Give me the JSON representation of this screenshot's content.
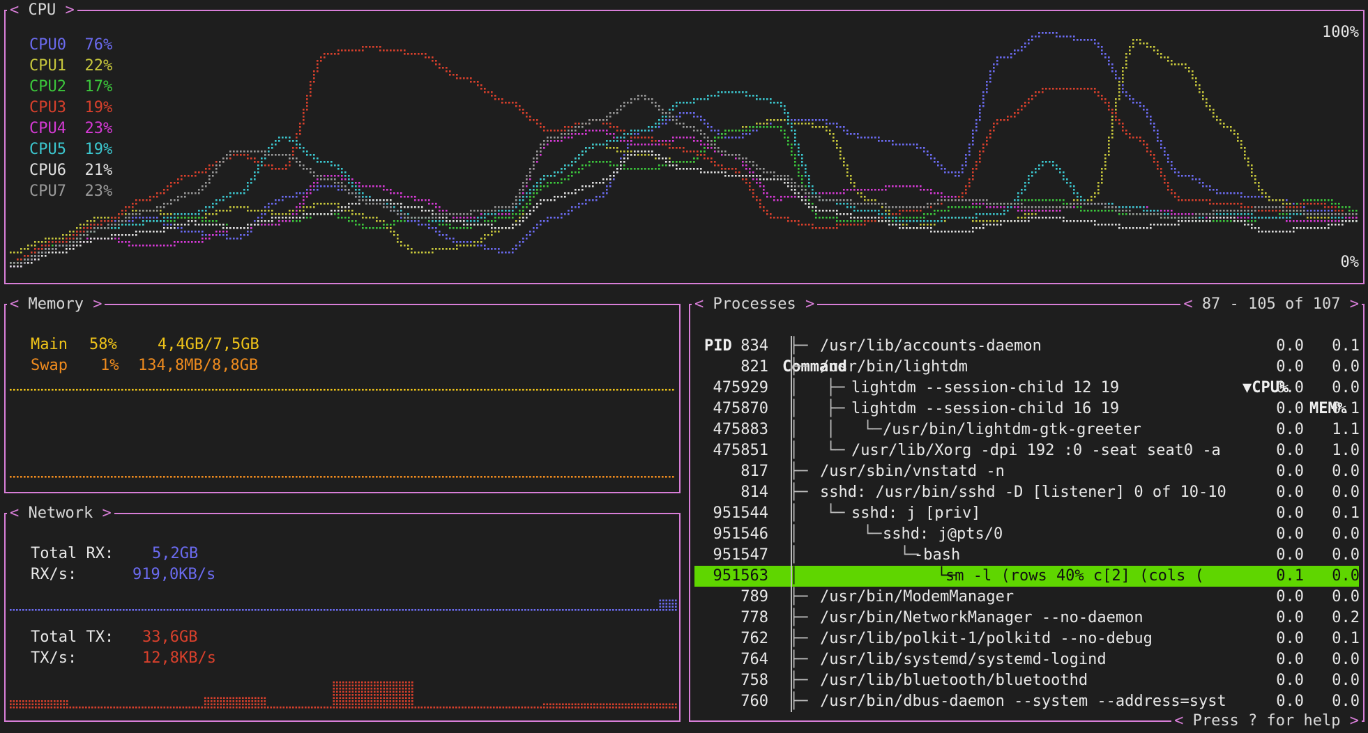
{
  "cpu_panel": {
    "title": "CPU",
    "max_label": "100%",
    "min_label": "0%"
  },
  "cpus": [
    {
      "name": "CPU0",
      "value": "76%",
      "color": "#6b6bf0"
    },
    {
      "name": "CPU1",
      "value": "22%",
      "color": "#c8c83c"
    },
    {
      "name": "CPU2",
      "value": "17%",
      "color": "#3cc83c"
    },
    {
      "name": "CPU3",
      "value": "19%",
      "color": "#d8402c"
    },
    {
      "name": "CPU4",
      "value": "23%",
      "color": "#d63ad6"
    },
    {
      "name": "CPU5",
      "value": "19%",
      "color": "#3cc8d0"
    },
    {
      "name": "CPU6",
      "value": "21%",
      "color": "#e0e0e0"
    },
    {
      "name": "CPU7",
      "value": "23%",
      "color": "#9a9a9a"
    }
  ],
  "memory": {
    "title": "Memory",
    "main": {
      "label": "Main",
      "percent": "58%",
      "amount": "4,4GB/7,5GB",
      "color": "#f0c419"
    },
    "swap": {
      "label": "Swap",
      "percent": "1%",
      "amount": "134,8MB/8,8GB",
      "color": "#f08c1e"
    }
  },
  "network": {
    "title": "Network",
    "rx_total_label": "Total RX:",
    "rx_total": "5,2GB",
    "rx_rate_label": "RX/s:",
    "rx_rate": "919,0KB/s",
    "rx_color": "#6b6bf0",
    "tx_total_label": "Total TX:",
    "tx_total": "33,6GB",
    "tx_rate_label": "TX/s:",
    "tx_rate": "12,8KB/s",
    "tx_color": "#d8402c"
  },
  "processes": {
    "title": "Processes",
    "range": "87 - 105 of 107",
    "footer": "Press ? for help",
    "headers": {
      "pid": "PID",
      "command": "Command",
      "cpu": "▼CPU%",
      "mem": "MEM%"
    },
    "rows": [
      {
        "pid": "834",
        "tree": "├─",
        "cmd": "/usr/lib/accounts-daemon",
        "cpu": "0.0",
        "mem": "0.1",
        "depth": 0
      },
      {
        "pid": "821",
        "tree": "├─",
        "cmd": "/usr/bin/lightdm",
        "cpu": "0.0",
        "mem": "0.0",
        "depth": 0
      },
      {
        "pid": "475929",
        "tree": "│   ├─",
        "cmd": "lightdm --session-child 12 19",
        "cpu": "0.0",
        "mem": "0.0",
        "depth": 1
      },
      {
        "pid": "475870",
        "tree": "│   ├─",
        "cmd": "lightdm --session-child 16 19",
        "cpu": "0.0",
        "mem": "0.1",
        "depth": 1
      },
      {
        "pid": "475883",
        "tree": "│   │   └─",
        "cmd": "/usr/bin/lightdm-gtk-greeter",
        "cpu": "0.0",
        "mem": "1.1",
        "depth": 2
      },
      {
        "pid": "475851",
        "tree": "│   └─",
        "cmd": "/usr/lib/Xorg -dpi 192 :0 -seat seat0 -a",
        "cpu": "0.0",
        "mem": "1.0",
        "depth": 1
      },
      {
        "pid": "817",
        "tree": "├─",
        "cmd": "/usr/sbin/vnstatd -n",
        "cpu": "0.0",
        "mem": "0.0",
        "depth": 0
      },
      {
        "pid": "814",
        "tree": "├─",
        "cmd": "sshd: /usr/bin/sshd -D [listener] 0 of 10-10",
        "cpu": "0.0",
        "mem": "0.0",
        "depth": 0
      },
      {
        "pid": "951544",
        "tree": "│   └─",
        "cmd": "sshd: j [priv]",
        "cpu": "0.0",
        "mem": "0.1",
        "depth": 1
      },
      {
        "pid": "951546",
        "tree": "│       └─",
        "cmd": "sshd: j@pts/0",
        "cpu": "0.0",
        "mem": "0.0",
        "depth": 2
      },
      {
        "pid": "951547",
        "tree": "│           └─",
        "cmd": "-bash",
        "cpu": "0.0",
        "mem": "0.0",
        "depth": 3
      },
      {
        "pid": "951563",
        "tree": "│               └─",
        "cmd": "sm -l (rows 40% c[2] (cols (",
        "cpu": "0.1",
        "mem": "0.0",
        "depth": 4,
        "selected": true
      },
      {
        "pid": "789",
        "tree": "├─",
        "cmd": "/usr/bin/ModemManager",
        "cpu": "0.0",
        "mem": "0.0",
        "depth": 0
      },
      {
        "pid": "778",
        "tree": "├─",
        "cmd": "/usr/bin/NetworkManager --no-daemon",
        "cpu": "0.0",
        "mem": "0.2",
        "depth": 0
      },
      {
        "pid": "762",
        "tree": "├─",
        "cmd": "/usr/lib/polkit-1/polkitd --no-debug",
        "cpu": "0.0",
        "mem": "0.1",
        "depth": 0
      },
      {
        "pid": "764",
        "tree": "├─",
        "cmd": "/usr/lib/systemd/systemd-logind",
        "cpu": "0.0",
        "mem": "0.0",
        "depth": 0
      },
      {
        "pid": "758",
        "tree": "├─",
        "cmd": "/usr/lib/bluetooth/bluetoothd",
        "cpu": "0.0",
        "mem": "0.0",
        "depth": 0
      },
      {
        "pid": "760",
        "tree": "├─",
        "cmd": "/usr/bin/dbus-daemon --system --address=syst",
        "cpu": "0.0",
        "mem": "0.0",
        "depth": 0
      }
    ]
  },
  "chart_data": [
    {
      "type": "line",
      "title": "CPU",
      "ylim": [
        0,
        100
      ],
      "x": [
        0,
        1,
        2,
        3,
        4,
        5,
        6,
        7,
        8,
        9,
        10,
        11,
        12,
        13,
        14,
        15,
        16,
        17,
        18,
        19,
        20,
        21,
        22,
        23,
        24,
        25,
        26,
        27,
        28,
        29,
        30
      ],
      "series": [
        {
          "name": "CPU0",
          "values": [
            2,
            12,
            20,
            22,
            16,
            14,
            30,
            35,
            30,
            20,
            12,
            8,
            22,
            30,
            58,
            65,
            55,
            62,
            62,
            55,
            52,
            40,
            88,
            98,
            95,
            70,
            40,
            32,
            30,
            25,
            22
          ]
        },
        {
          "name": "CPU1",
          "values": [
            8,
            14,
            22,
            25,
            22,
            26,
            24,
            28,
            22,
            8,
            10,
            18,
            40,
            52,
            48,
            45,
            58,
            62,
            60,
            30,
            18,
            22,
            20,
            25,
            30,
            95,
            85,
            60,
            30,
            22,
            20
          ]
        },
        {
          "name": "CPU2",
          "values": [
            4,
            10,
            18,
            20,
            22,
            18,
            20,
            24,
            18,
            22,
            18,
            22,
            36,
            45,
            42,
            45,
            58,
            60,
            22,
            20,
            22,
            26,
            28,
            30,
            25,
            24,
            22,
            20,
            22,
            30,
            25
          ]
        },
        {
          "name": "CPU3",
          "values": [
            4,
            12,
            20,
            30,
            40,
            48,
            42,
            90,
            92,
            90,
            80,
            70,
            58,
            62,
            55,
            50,
            42,
            22,
            18,
            20,
            25,
            30,
            62,
            75,
            75,
            55,
            30,
            28,
            25,
            28,
            22
          ]
        },
        {
          "name": "CPU4",
          "values": [
            2,
            10,
            14,
            10,
            12,
            18,
            20,
            40,
            35,
            30,
            22,
            24,
            54,
            58,
            52,
            55,
            48,
            30,
            32,
            34,
            35,
            30,
            26,
            25,
            28,
            26,
            24,
            22,
            22,
            20,
            22
          ]
        },
        {
          "name": "CPU5",
          "values": [
            3,
            10,
            18,
            20,
            24,
            32,
            55,
            45,
            30,
            22,
            20,
            25,
            40,
            52,
            58,
            70,
            74,
            70,
            30,
            25,
            20,
            22,
            24,
            45,
            28,
            26,
            22,
            24,
            22,
            24,
            20
          ]
        },
        {
          "name": "CPU6",
          "values": [
            2,
            8,
            14,
            16,
            20,
            18,
            22,
            24,
            30,
            26,
            20,
            18,
            30,
            36,
            50,
            42,
            40,
            38,
            25,
            22,
            18,
            16,
            20,
            22,
            20,
            18,
            20,
            22,
            16,
            18,
            21
          ]
        },
        {
          "name": "CPU7",
          "values": [
            3,
            10,
            18,
            25,
            32,
            50,
            48,
            38,
            28,
            22,
            24,
            26,
            55,
            62,
            72,
            60,
            48,
            40,
            30,
            28,
            26,
            30,
            28,
            26,
            28,
            24,
            22,
            25,
            26,
            24,
            23
          ]
        }
      ]
    },
    {
      "type": "line",
      "title": "Memory",
      "series": [
        {
          "name": "Main",
          "values": [
            58,
            58,
            58,
            58,
            58,
            58,
            58,
            58,
            58,
            58,
            58,
            58,
            58,
            58,
            58,
            58,
            58,
            58,
            58,
            58
          ]
        },
        {
          "name": "Swap",
          "values": [
            1,
            1,
            1,
            1,
            1,
            1,
            1,
            1,
            1,
            1,
            1,
            1,
            1,
            1,
            1,
            1,
            1,
            1,
            1,
            1
          ]
        }
      ]
    },
    {
      "type": "bar",
      "title": "Network",
      "series": [
        {
          "name": "RX",
          "values": [
            1,
            1,
            1,
            1,
            1,
            1,
            1,
            1,
            1,
            1,
            1,
            1,
            1,
            1,
            1,
            1,
            1,
            1,
            1,
            1,
            1,
            1,
            1,
            1,
            1,
            1,
            1,
            1,
            1,
            1,
            1,
            1,
            1,
            1,
            1,
            1,
            1,
            1,
            1,
            1,
            1,
            1,
            1,
            1,
            1,
            1,
            1,
            1,
            1,
            1,
            1,
            1,
            1,
            1,
            1,
            1,
            1,
            1,
            1,
            1,
            1,
            1,
            1,
            1,
            1,
            1,
            1,
            1,
            1,
            1,
            1,
            1,
            1,
            1,
            1,
            1,
            1,
            1,
            1,
            1,
            1,
            1,
            1,
            1,
            1,
            1,
            1,
            1,
            1,
            1,
            1,
            1,
            1,
            1,
            1,
            1,
            1,
            4,
            4,
            4
          ]
        },
        {
          "name": "TX",
          "values": [
            3,
            3,
            3,
            3,
            3,
            3,
            3,
            3,
            3,
            1,
            1,
            1,
            1,
            1,
            1,
            1,
            1,
            1,
            1,
            1,
            1,
            1,
            1,
            1,
            1,
            1,
            1,
            1,
            1,
            1,
            4,
            4,
            4,
            4,
            4,
            4,
            4,
            4,
            4,
            4,
            1,
            1,
            1,
            1,
            1,
            1,
            1,
            1,
            1,
            1,
            9,
            9,
            9,
            9,
            9,
            9,
            9,
            9,
            9,
            9,
            9,
            9,
            9,
            1,
            1,
            1,
            1,
            1,
            1,
            1,
            1,
            1,
            1,
            1,
            1,
            1,
            1,
            1,
            1,
            1,
            1,
            1,
            1,
            2,
            2,
            2,
            2,
            2,
            2,
            2,
            2,
            2,
            2,
            2,
            2,
            2,
            2,
            2,
            2,
            2,
            2,
            2,
            2,
            2
          ]
        }
      ]
    }
  ]
}
